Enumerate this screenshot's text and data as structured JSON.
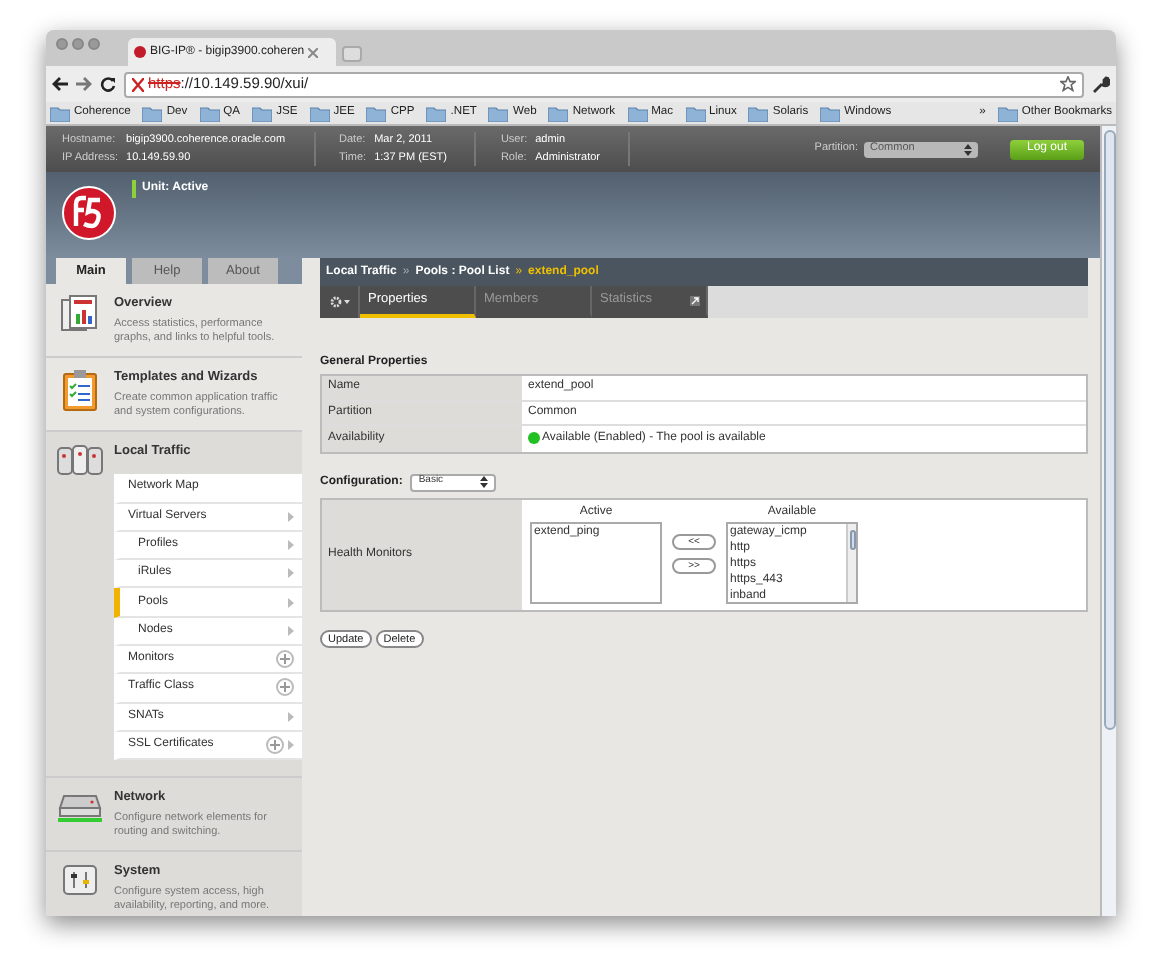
{
  "browser": {
    "tab_title": "BIG-IP® - bigip3900.coheren",
    "url_scheme": "https",
    "url_rest": "://10.149.59.90/xui/",
    "bookmarks": [
      "Coherence",
      "Dev",
      "QA",
      "JSE",
      "JEE",
      "CPP",
      ".NET",
      "Web",
      "Network",
      "Mac",
      "Linux",
      "Solaris",
      "Windows"
    ],
    "bookmarks_more": "»",
    "other_bookmarks": "Other Bookmarks"
  },
  "header": {
    "info": [
      {
        "label": "Hostname:",
        "value": "bigip3900.coherence.oracle.com"
      },
      {
        "label": "IP Address:",
        "value": "10.149.59.90"
      },
      {
        "label": "Date:",
        "value": "Mar 2, 2011"
      },
      {
        "label": "Time:",
        "value": "1:37 PM (EST)"
      },
      {
        "label": "User:",
        "value": "admin"
      },
      {
        "label": "Role:",
        "value": "Administrator"
      }
    ],
    "partition_label": "Partition:",
    "partition_value": "Common",
    "logout": "Log out",
    "unit_status": "Unit: Active"
  },
  "sidebar": {
    "tabs": [
      {
        "label": "Main",
        "selected": true
      },
      {
        "label": "Help",
        "selected": false
      },
      {
        "label": "About",
        "selected": false
      }
    ],
    "sections": [
      {
        "kind": "overview",
        "title": "Overview",
        "desc": "Access statistics, performance graphs, and links to helpful tools."
      },
      {
        "kind": "templates",
        "title": "Templates and Wizards",
        "desc": "Create common application traffic and system configurations."
      },
      {
        "kind": "traffic",
        "title": "Local Traffic",
        "items": [
          {
            "label": "Network Map",
            "kind": "plain",
            "selected": false
          },
          {
            "label": "Virtual Servers",
            "kind": "arrow",
            "selected": false,
            "children": [
              {
                "label": "Profiles",
                "kind": "arrow",
                "selected": false
              },
              {
                "label": "iRules",
                "kind": "arrow",
                "selected": false
              },
              {
                "label": "Pools",
                "kind": "arrow",
                "selected": true
              },
              {
                "label": "Nodes",
                "kind": "arrow",
                "selected": false
              }
            ]
          },
          {
            "label": "Monitors",
            "kind": "plus",
            "selected": false
          },
          {
            "label": "Traffic Class",
            "kind": "plus",
            "selected": false
          },
          {
            "label": "SNATs",
            "kind": "arrow",
            "selected": false
          },
          {
            "label": "SSL Certificates",
            "kind": "plus-arrow",
            "selected": false
          }
        ]
      },
      {
        "kind": "network",
        "title": "Network",
        "desc": "Configure network elements for routing and switching."
      },
      {
        "kind": "system",
        "title": "System",
        "desc": "Configure system access, high availability, reporting, and more."
      }
    ]
  },
  "breadcrumb": [
    "Local Traffic",
    "Pools : Pool List",
    "extend_pool"
  ],
  "breadcrumb_sep": "»",
  "subtabs": [
    {
      "label": "Properties",
      "selected": true
    },
    {
      "label": "Members",
      "selected": false
    },
    {
      "label": "Statistics",
      "selected": false
    }
  ],
  "general": {
    "title": "General Properties",
    "rows": [
      {
        "label": "Name",
        "value": "extend_pool"
      },
      {
        "label": "Partition",
        "value": "Common"
      },
      {
        "label": "Availability",
        "value": "Available (Enabled) - The pool is available",
        "color": "#22c022"
      }
    ]
  },
  "configuration": {
    "label": "Configuration:",
    "value": "Basic"
  },
  "health": {
    "label": "Health Monitors",
    "active_title": "Active",
    "active": [
      "extend_ping"
    ],
    "available_title": "Available",
    "available": [
      "gateway_icmp",
      "http",
      "https",
      "https_443",
      "inband"
    ],
    "add": "<<",
    "remove": ">>"
  },
  "buttons": [
    "Update",
    "Delete"
  ]
}
